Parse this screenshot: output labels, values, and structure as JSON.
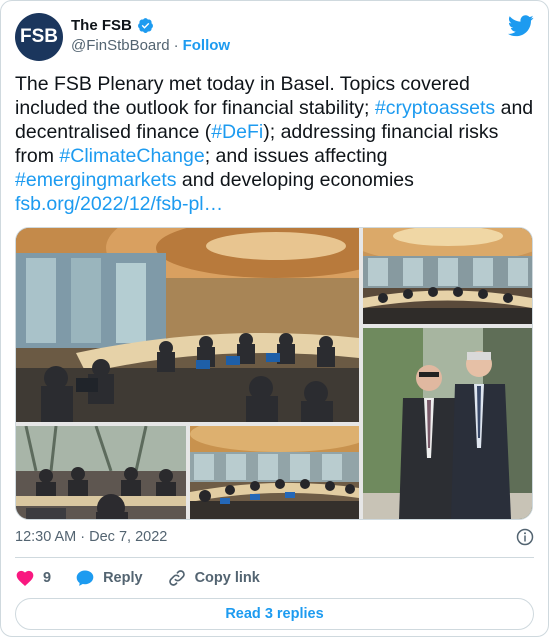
{
  "author": {
    "avatar_text": "FSB",
    "display_name": "The FSB",
    "handle": "@FinStbBoard",
    "separator": "·",
    "follow_label": "Follow"
  },
  "tweet": {
    "parts": [
      {
        "text": "The FSB Plenary met today in Basel. Topics covered included the outlook for financial stability; ",
        "kind": "text"
      },
      {
        "text": "#cryptoassets",
        "kind": "tag"
      },
      {
        "text": " and decentralised finance (",
        "kind": "text"
      },
      {
        "text": "#DeFi",
        "kind": "tag"
      },
      {
        "text": "); addressing financial risks from ",
        "kind": "text"
      },
      {
        "text": "#ClimateChange",
        "kind": "tag"
      },
      {
        "text": "; and issues affecting ",
        "kind": "text"
      },
      {
        "text": "#emergingmarkets",
        "kind": "tag"
      },
      {
        "text": " and developing economies ",
        "kind": "text"
      },
      {
        "text": "fsb.org/2022/12/fsb-pl…",
        "kind": "link"
      }
    ],
    "timestamp": "12:30 AM · Dec 7, 2022"
  },
  "actions": {
    "like_count": "9",
    "reply_label": "Reply",
    "copy_link_label": "Copy link",
    "read_replies_label": "Read 3 replies"
  },
  "colors": {
    "accent": "#1d9bf0",
    "like": "#f91880",
    "secondary_text": "#536471",
    "border": "#cfd9de"
  }
}
